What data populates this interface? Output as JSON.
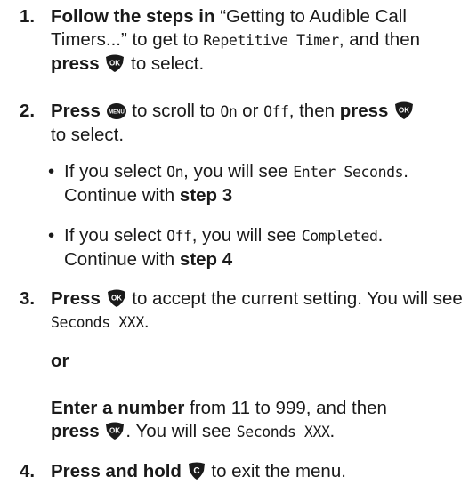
{
  "steps": {
    "s1": {
      "num": "1.",
      "b1": "Follow the steps in",
      "t1": "“Getting to Audible Call Timers...” to get to",
      "lcd1": "Repetitive Timer",
      "t2": ", and then",
      "b2": "press",
      "t3": "to select."
    },
    "s2": {
      "num": "2.",
      "b1": "Press",
      "t1": "to scroll to",
      "lcd1": "On",
      "t2": "or",
      "lcd2": "Off",
      "t3": ", then",
      "b2": "press",
      "t4": "to select."
    },
    "bullets": [
      {
        "dot": "•",
        "t1": "If you select",
        "lcd1": "On",
        "t2": ", you will see",
        "lcd2": "Enter Seconds",
        "t3": ".",
        "t4": "Continue with",
        "b1": "step 3"
      },
      {
        "dot": "•",
        "t1": "If you select",
        "lcd1": "Off",
        "t2": ", you will see",
        "lcd2": "Completed",
        "t3": ".",
        "t4": "Continue with",
        "b1": "step 4"
      }
    ],
    "s3": {
      "num": "3.",
      "b1": "Press",
      "t1": "to accept the current setting. You will see",
      "lcd1": "Seconds XXX",
      "t2": ".",
      "or": "or",
      "b2": "Enter a number",
      "t3": "from 11 to 999, and then",
      "b3": "press",
      "t4": ". You will see",
      "lcd2": "Seconds XXX",
      "t5": "."
    },
    "s4": {
      "num": "4.",
      "b1": "Press and hold",
      "t1": "to exit the menu."
    }
  },
  "keys": {
    "ok": "OK",
    "menu": "MENU",
    "clear": "C"
  }
}
